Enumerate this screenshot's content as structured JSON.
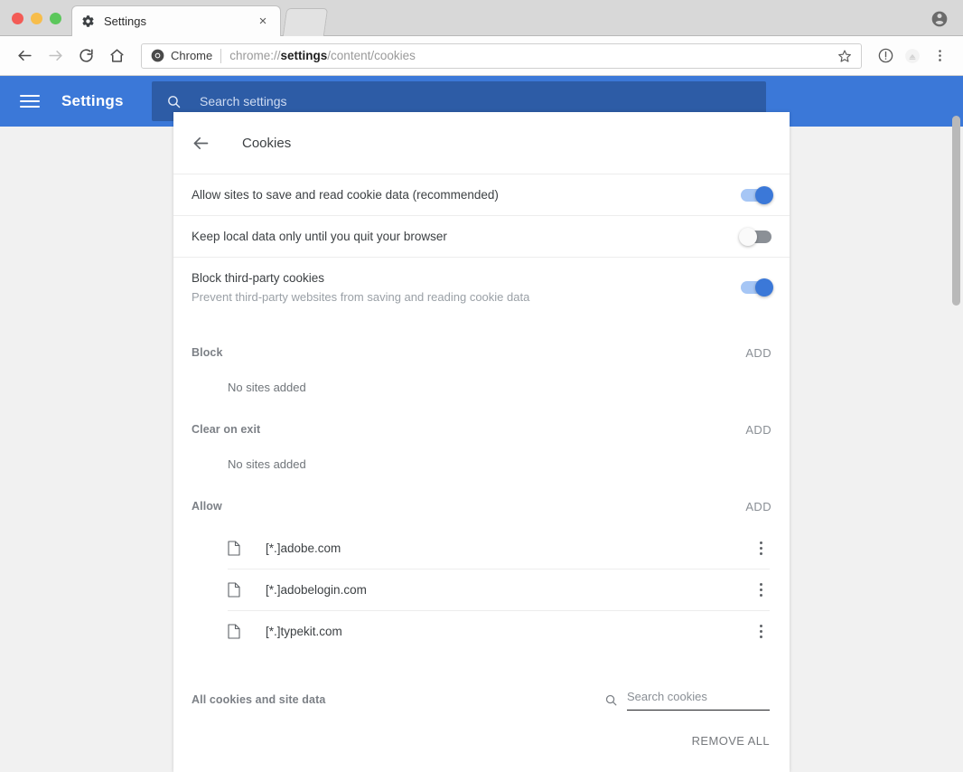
{
  "window": {
    "traffic_lights": [
      "close",
      "minimize",
      "zoom"
    ],
    "tab": {
      "title": "Settings",
      "favicon": "gear-icon",
      "close_label": "×"
    },
    "profile_icon": "account-avatar-icon"
  },
  "toolbar": {
    "back_icon": "back-arrow-icon",
    "forward_icon": "forward-arrow-icon",
    "reload_icon": "reload-icon",
    "home_icon": "home-icon",
    "security_label": "Chrome",
    "url_prefix": "chrome://",
    "url_bold": "settings",
    "url_suffix": "/content/cookies",
    "bookmark_icon": "star-icon",
    "info_icon": "info-circle-icon",
    "extension_icon": "extension-icon",
    "menu_icon": "three-dot-menu-icon"
  },
  "settings_header": {
    "menu_icon": "hamburger-menu-icon",
    "title": "Settings",
    "search_icon": "search-icon",
    "search_placeholder": "Search settings",
    "accent_color": "#3b78d8",
    "search_bg_color": "#2d5ca6"
  },
  "page": {
    "back_icon": "back-arrow-icon",
    "title": "Cookies",
    "toggles": [
      {
        "primary": "Allow sites to save and read cookie data (recommended)",
        "secondary": "",
        "state": "on"
      },
      {
        "primary": "Keep local data only until you quit your browser",
        "secondary": "",
        "state": "off"
      },
      {
        "primary": "Block third-party cookies",
        "secondary": "Prevent third-party websites from saving and reading cookie data",
        "state": "on"
      }
    ],
    "sections": [
      {
        "title": "Block",
        "add_label": "ADD",
        "empty_text": "No sites added",
        "sites": []
      },
      {
        "title": "Clear on exit",
        "add_label": "ADD",
        "empty_text": "No sites added",
        "sites": []
      },
      {
        "title": "Allow",
        "add_label": "ADD",
        "empty_text": "",
        "sites": [
          {
            "name": "[*.]adobe.com",
            "icon": "page-file-icon",
            "menu_icon": "three-dot-menu-icon"
          },
          {
            "name": "[*.]adobelogin.com",
            "icon": "page-file-icon",
            "menu_icon": "three-dot-menu-icon"
          },
          {
            "name": "[*.]typekit.com",
            "icon": "page-file-icon",
            "menu_icon": "three-dot-menu-icon"
          }
        ]
      }
    ],
    "all_cookies": {
      "title": "All cookies and site data",
      "search_icon": "search-icon",
      "search_placeholder": "Search cookies",
      "remove_all_label": "REMOVE ALL"
    }
  }
}
